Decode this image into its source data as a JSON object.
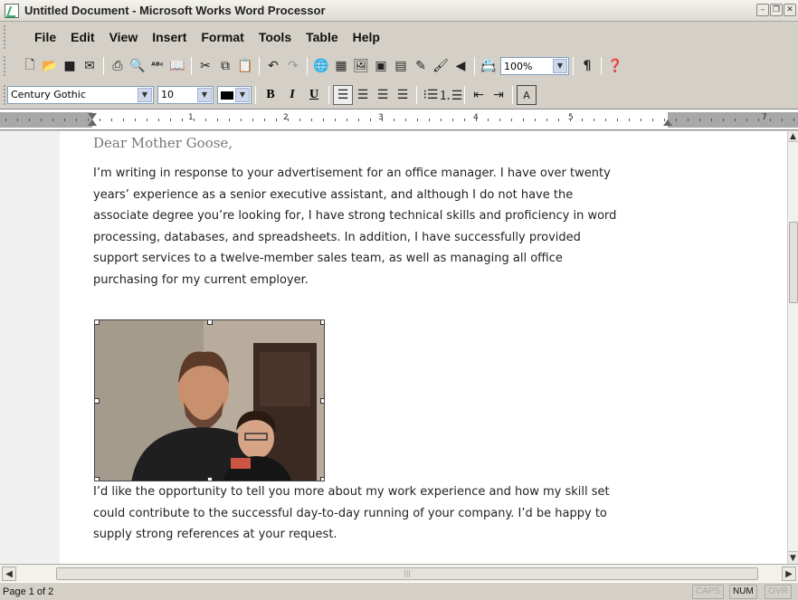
{
  "window": {
    "title": "Untitled Document - Microsoft Works Word Processor"
  },
  "menu": [
    "File",
    "Edit",
    "View",
    "Insert",
    "Format",
    "Tools",
    "Table",
    "Help"
  ],
  "toolbar": {
    "zoom": "100%",
    "icons": [
      "new-doc",
      "open",
      "save",
      "email",
      "print",
      "print-preview",
      "spell-check",
      "thesaurus",
      "cut",
      "copy",
      "paste",
      "undo",
      "redo",
      "hyperlink",
      "insert-table",
      "clip-art",
      "picture",
      "chart",
      "drawing",
      "paint",
      "sound",
      "address-book",
      "zoom",
      "show-paragraph",
      "help"
    ]
  },
  "format_bar": {
    "font": "Century Gothic",
    "size": "10",
    "bold": "B",
    "italic": "I",
    "underline": "U"
  },
  "ruler": {
    "numbers": [
      "1",
      "2",
      "3",
      "4",
      "5",
      "7"
    ]
  },
  "document": {
    "salutation": "Dear Mother Goose,",
    "para1": [
      "I’m writing in response to your advertisement for an office manager. I have over twenty",
      "years’ experience as a senior executive assistant, and although I do not have the",
      "associate degree you’re looking for, I have strong technical skills and proficiency in word",
      "processing, databases, and spreadsheets. In addition, I have successfully provided",
      "support services to a twelve-member sales team, as well as managing all office",
      "purchasing for my current employer."
    ],
    "para2": [
      "I’d like the opportunity to tell you more about my work experience and how my skill set",
      "could contribute to the successful day-to-day running of your company. I’d be happy to",
      "supply strong references at your request."
    ]
  },
  "status": {
    "page": "Page 1 of 2",
    "caps": "CAPS",
    "num": "NUM",
    "ovr": "OVR"
  }
}
